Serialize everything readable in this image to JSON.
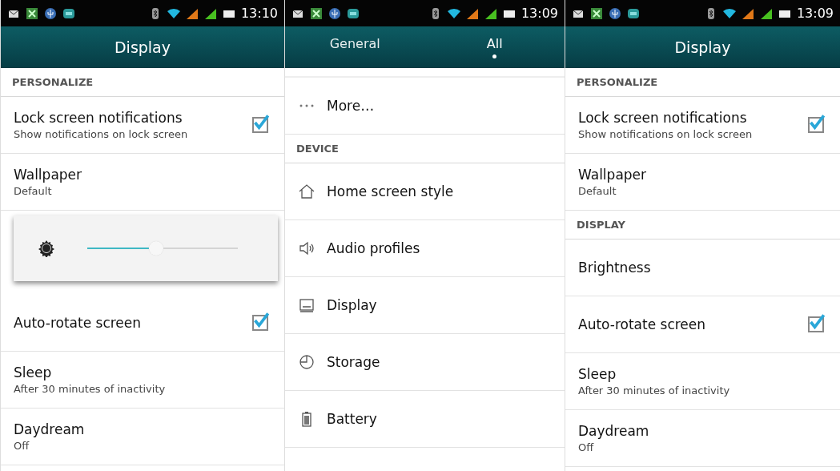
{
  "screens": [
    {
      "status_bar": {
        "time": "13:10"
      },
      "header": {
        "kind": "title",
        "title": "Display"
      },
      "list": [
        {
          "kind": "section",
          "label": "PERSONALIZE"
        },
        {
          "kind": "item",
          "title": "Lock screen notifications",
          "subtitle": "Show notifications on lock screen",
          "checked": true
        },
        {
          "kind": "item",
          "title": "Wallpaper",
          "subtitle": "Default"
        },
        {
          "kind": "brightness_dialog",
          "level": 0.46
        },
        {
          "kind": "item",
          "title": "Auto-rotate screen",
          "checked": true
        },
        {
          "kind": "item",
          "title": "Sleep",
          "subtitle": "After 30 minutes of inactivity"
        },
        {
          "kind": "item",
          "title": "Daydream",
          "subtitle": "Off"
        }
      ]
    },
    {
      "status_bar": {
        "time": "13:09"
      },
      "header": {
        "kind": "tabs",
        "tabs": [
          {
            "label": "General",
            "selected": false
          },
          {
            "label": "All",
            "selected": true
          }
        ]
      },
      "list": [
        {
          "kind": "icon_item",
          "title": "More…"
        },
        {
          "kind": "section",
          "label": "DEVICE"
        },
        {
          "kind": "icon_item",
          "title": "Home screen style"
        },
        {
          "kind": "icon_item",
          "title": "Audio profiles"
        },
        {
          "kind": "icon_item",
          "title": "Display"
        },
        {
          "kind": "icon_item",
          "title": "Storage"
        },
        {
          "kind": "icon_item",
          "title": "Battery"
        }
      ]
    },
    {
      "status_bar": {
        "time": "13:09"
      },
      "header": {
        "kind": "title",
        "title": "Display"
      },
      "list": [
        {
          "kind": "section",
          "label": "PERSONALIZE"
        },
        {
          "kind": "item",
          "title": "Lock screen notifications",
          "subtitle": "Show notifications on lock screen",
          "checked": true
        },
        {
          "kind": "item",
          "title": "Wallpaper",
          "subtitle": "Default"
        },
        {
          "kind": "section",
          "label": "DISPLAY"
        },
        {
          "kind": "item",
          "title": "Brightness"
        },
        {
          "kind": "item",
          "title": "Auto-rotate screen",
          "checked": true
        },
        {
          "kind": "item",
          "title": "Sleep",
          "subtitle": "After 30 minutes of inactivity"
        },
        {
          "kind": "item",
          "title": "Daydream",
          "subtitle": "Off"
        }
      ]
    }
  ]
}
